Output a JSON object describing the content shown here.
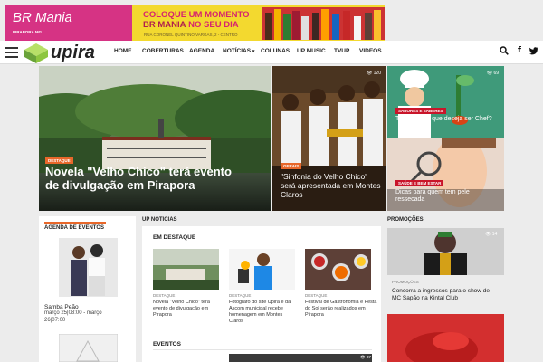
{
  "banner": {
    "brand": "BR Mania",
    "brand_sub": "PIRAPORA MG",
    "tagline_a": "COLOQUE UM MOMENTO",
    "tagline_b": "BR MANIA",
    "tagline_c": "NO SEU DIA",
    "address": "RUA CORONEL QUINTINO VARGAS, 2 - CENTRO"
  },
  "header": {
    "logo": "upira",
    "nav": [
      "HOME",
      "COBERTURAS",
      "AGENDA",
      "NOTÍCIAS",
      "COLUNAS",
      "UP MUSIC",
      "TVUP",
      "VIDEOS"
    ],
    "icons": [
      "search-icon",
      "facebook-icon",
      "twitter-icon"
    ]
  },
  "hero": {
    "main": {
      "category": "DESTAQUE",
      "title": "Novela \"Velho Chico\" terá evento de divulgação em Pirapora"
    },
    "middle": {
      "category": "GERAIS",
      "title": "\"Sinfonia do Velho Chico\" será apresentada em Montes Claros",
      "views": "120"
    },
    "top_right": {
      "category": "SABORES E SABERES",
      "title": "Tem certeza que deseja ser Chef?",
      "views": "69"
    },
    "bottom_right": {
      "category": "SAÚDE E BEM ESTAR",
      "title": "Dicas para quem tem pele ressecada"
    }
  },
  "agenda": {
    "title": "AGENDA DE EVENTOS",
    "event_name": "Samba Peão",
    "event_dates": "março 25|08:00 - março 26|07:00"
  },
  "up_noticias": {
    "title": "UP NOTICIAS",
    "section_title": "EM DESTAQUE",
    "items": [
      {
        "category": "DESTAQUE",
        "title": "Novela \"Velho Chico\" terá evento de divulgação em Pirapora"
      },
      {
        "category": "DESTAQUE",
        "title": "Fotógrafo do site Upira e da Ascom municipal recebe homenagem em Montes Claros"
      },
      {
        "category": "DESTAQUE",
        "title": "Festival de Gastronomia e Festa do Sol serão realizados em Pirapora"
      }
    ],
    "events_title": "EVENTOS",
    "events_views": "37"
  },
  "promocoes": {
    "title": "PROMOÇÕES",
    "views": "14",
    "category": "PROMOÇÕES",
    "headline": "Concorra a ingressos para o show de MC Sapão na Kintal Club"
  },
  "colors": {
    "accent": "#e8672a",
    "danger": "#c9152a",
    "brand_green": "#8dc63f"
  }
}
